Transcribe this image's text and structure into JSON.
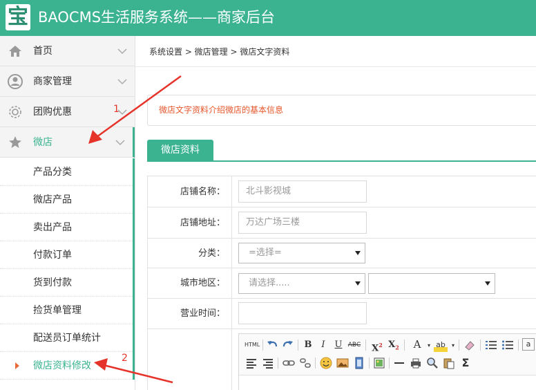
{
  "header": {
    "logo_char": "宝",
    "title": "BAOCMS生活服务系统——商家后台"
  },
  "sidebar": {
    "groups": [
      {
        "label": "首页"
      },
      {
        "label": "商家管理"
      },
      {
        "label": "团购优惠"
      },
      {
        "label": "微店"
      }
    ],
    "sub_items": [
      {
        "label": "产品分类"
      },
      {
        "label": "微店产品"
      },
      {
        "label": "卖出产品"
      },
      {
        "label": "付款订单"
      },
      {
        "label": "货到付款"
      },
      {
        "label": "捡货单管理"
      },
      {
        "label": "配送员订单统计"
      },
      {
        "label": "微店资料修改"
      }
    ]
  },
  "breadcrumb": "系统设置 > 微店管理 > 微店文字资料",
  "notice": "微店文字资料介绍微店的基本信息",
  "tab": "微店资料",
  "form": {
    "shop_name_label": "店铺名称：",
    "shop_name_value": "北斗影视城",
    "shop_addr_label": "店铺地址：",
    "shop_addr_value": "万达广场三楼",
    "category_label": "分类：",
    "category_value": "=选择=",
    "city_label": "城市地区：",
    "city_value": "请选择.....",
    "hours_label": "营业时间："
  },
  "annotations": {
    "n1": "1",
    "n2": "2"
  },
  "colors": {
    "brand": "#3bb391",
    "notice": "#e6562b",
    "annotation": "#e5332a"
  }
}
